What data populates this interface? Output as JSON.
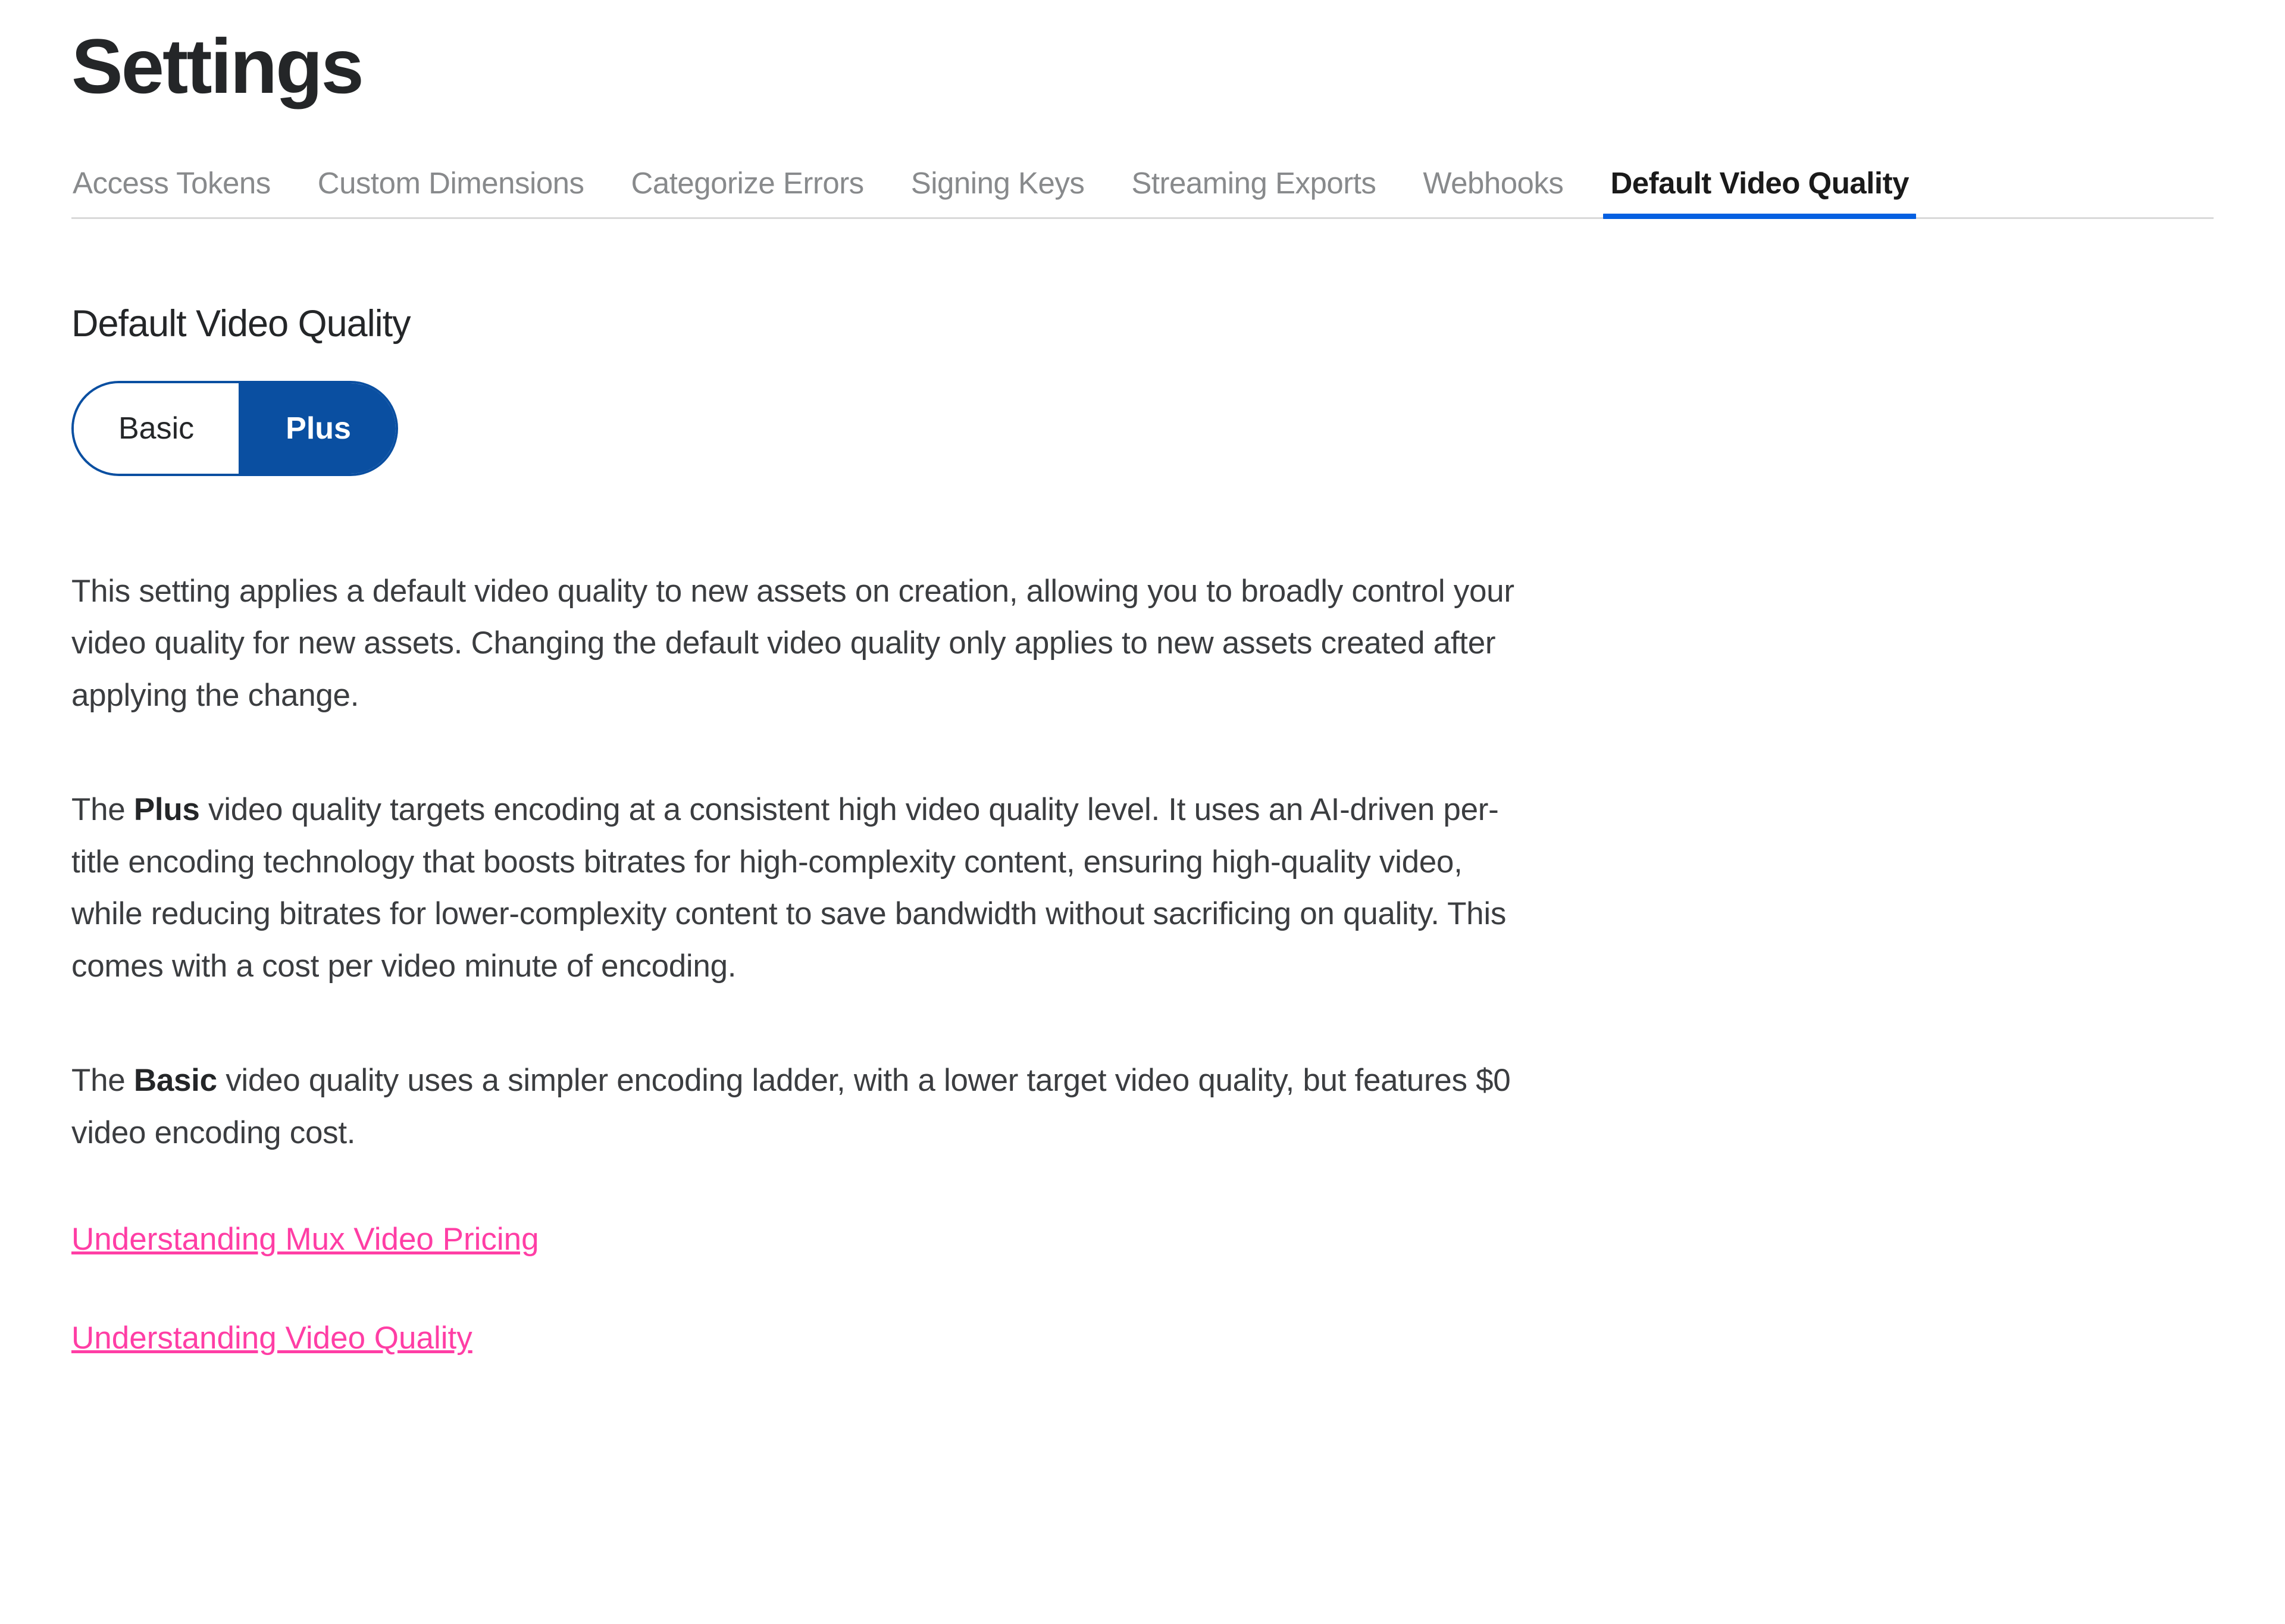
{
  "page_title": "Settings",
  "tabs": [
    {
      "label": "Access Tokens",
      "active": false
    },
    {
      "label": "Custom Dimensions",
      "active": false
    },
    {
      "label": "Categorize Errors",
      "active": false
    },
    {
      "label": "Signing Keys",
      "active": false
    },
    {
      "label": "Streaming Exports",
      "active": false
    },
    {
      "label": "Webhooks",
      "active": false
    },
    {
      "label": "Default Video Quality",
      "active": true
    }
  ],
  "section_heading": "Default Video Quality",
  "quality_toggle": {
    "options": [
      {
        "label": "Basic",
        "selected": false
      },
      {
        "label": "Plus",
        "selected": true
      }
    ]
  },
  "description": {
    "para1": "This setting applies a default video quality to new assets on creation, allowing you to broadly control your video quality for new assets. Changing the default video quality only applies to new assets created after applying the change.",
    "para2_prefix": "The ",
    "para2_bold": "Plus",
    "para2_rest": " video quality targets encoding at a consistent high video quality level. It uses an AI-driven per-title encoding technology that boosts bitrates for high-complexity content, ensuring high-quality video, while reducing bitrates for lower-complexity content to save bandwidth without sacrificing on quality. This comes with a cost per video minute of encoding.",
    "para3_prefix": "The ",
    "para3_bold": "Basic",
    "para3_rest": " video quality uses a simpler encoding ladder, with a lower target video quality, but features $0 video encoding cost."
  },
  "links": [
    "Understanding Mux Video Pricing",
    "Understanding Video Quality"
  ]
}
